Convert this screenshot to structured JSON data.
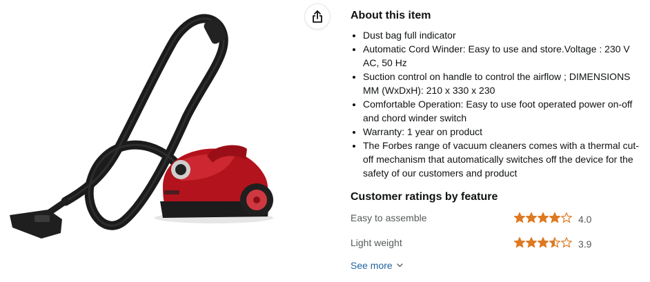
{
  "about": {
    "title": "About this item",
    "bullets": [
      "Dust bag full indicator",
      "Automatic Cord Winder: Easy to use and store.Voltage : 230 V AC, 50 Hz",
      "Suction control on handle to control the airflow ; DIMENSIONS MM (WxDxH): 210 x 330 x 230",
      "Comfortable Operation: Easy to use foot operated power on-off and chord winder switch",
      "Warranty: 1 year on product",
      "The Forbes range of vacuum cleaners comes with a thermal cut-off mechanism that automatically switches off the device for the safety of our customers and product"
    ]
  },
  "ratings": {
    "title": "Customer ratings by feature",
    "items": [
      {
        "feature": "Easy to assemble",
        "value": "4.0",
        "stars": 4.0
      },
      {
        "feature": "Light weight",
        "value": "3.9",
        "stars": 3.5
      }
    ],
    "see_more": "See more"
  },
  "colors": {
    "star": "#de7921",
    "link": "#2162a1",
    "vacuum_body": "#b3131c"
  },
  "icons": {
    "share": "share-icon",
    "chevron": "chevron-down-icon"
  }
}
